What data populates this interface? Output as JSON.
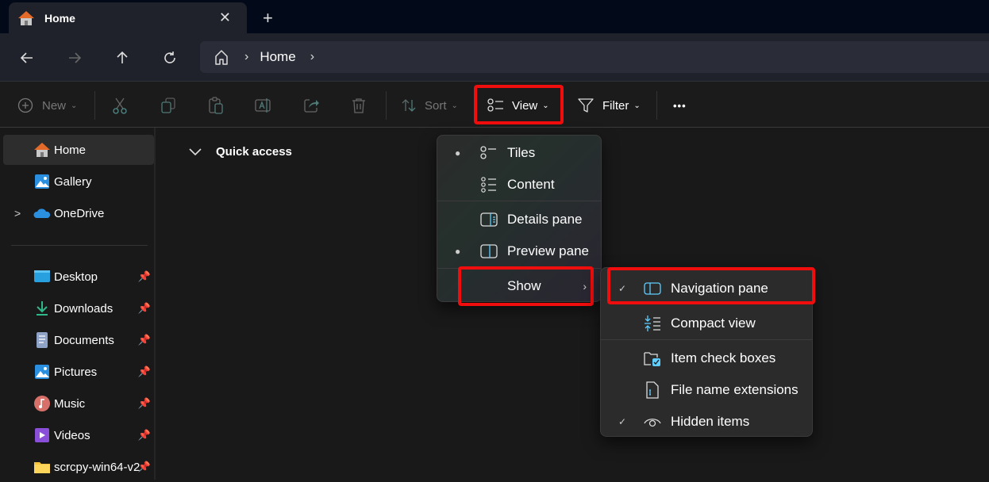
{
  "window": {
    "tab_title": "Home",
    "tab_icon": "home-icon",
    "close_tab_symbol": "✕",
    "new_tab_symbol": "+"
  },
  "navigation": {
    "back": "arrow-left-icon",
    "forward": "arrow-right-icon",
    "up": "arrow-up-icon",
    "refresh": "refresh-icon",
    "breadcrumb": [
      "Home"
    ],
    "separator": "›"
  },
  "command_bar": {
    "new_label": "New",
    "sort_label": "Sort",
    "view_label": "View",
    "filter_label": "Filter",
    "more_label": "•••",
    "icons": [
      "cut-icon",
      "copy-icon",
      "paste-icon",
      "rename-icon",
      "share-icon",
      "delete-icon"
    ]
  },
  "sidebar": {
    "items": [
      {
        "label": "Home",
        "icon": "home-icon",
        "selected": true
      },
      {
        "label": "Gallery",
        "icon": "gallery-icon"
      },
      {
        "label": "OneDrive",
        "icon": "onedrive-icon",
        "expandable": true
      }
    ],
    "pinned": [
      {
        "label": "Desktop",
        "icon": "desktop-icon"
      },
      {
        "label": "Downloads",
        "icon": "downloads-icon"
      },
      {
        "label": "Documents",
        "icon": "documents-icon"
      },
      {
        "label": "Pictures",
        "icon": "pictures-icon"
      },
      {
        "label": "Music",
        "icon": "music-icon"
      },
      {
        "label": "Videos",
        "icon": "videos-icon"
      },
      {
        "label": "scrcpy-win64-v2",
        "icon": "folder-icon"
      }
    ]
  },
  "main": {
    "section_title": "Quick access"
  },
  "view_menu": {
    "items": [
      {
        "label": "Tiles",
        "bullet": true
      },
      {
        "label": "Content",
        "bullet": false
      },
      {
        "label": "Details pane",
        "bullet": false
      },
      {
        "label": "Preview pane",
        "bullet": true
      },
      {
        "label": "Show",
        "submenu": true
      }
    ]
  },
  "show_submenu": {
    "items": [
      {
        "label": "Navigation pane",
        "checked": true
      },
      {
        "label": "Compact view",
        "checked": false
      },
      {
        "label": "Item check boxes",
        "checked": false
      },
      {
        "label": "File name extensions",
        "checked": false
      },
      {
        "label": "Hidden items",
        "checked": true
      }
    ]
  },
  "colors": {
    "highlight": "#f00d0d",
    "accent": "#60cdff"
  }
}
